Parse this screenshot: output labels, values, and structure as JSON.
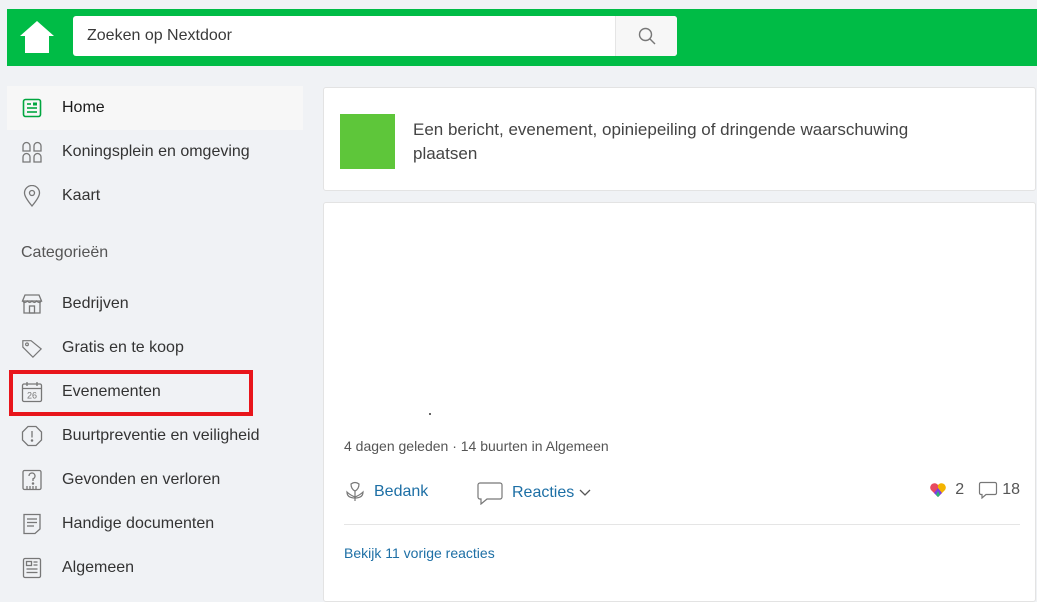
{
  "search": {
    "placeholder": "Zoeken op Nextdoor"
  },
  "sidebar": {
    "items": [
      {
        "label": "Home",
        "icon": "newsfeed-icon"
      },
      {
        "label": "Koningsplein en omgeving",
        "icon": "neighborhood-icon"
      },
      {
        "label": "Kaart",
        "icon": "map-pin-icon"
      }
    ],
    "categories_title": "Categorieën",
    "categories": [
      {
        "label": "Bedrijven",
        "icon": "store-icon"
      },
      {
        "label": "Gratis en te koop",
        "icon": "price-tag-icon"
      },
      {
        "label": "Evenementen",
        "icon": "calendar-icon",
        "calendar_day": "26"
      },
      {
        "label": "Buurtpreventie en veiligheid",
        "icon": "alert-icon"
      },
      {
        "label": "Gevonden en verloren",
        "icon": "lost-found-icon"
      },
      {
        "label": "Handige documenten",
        "icon": "document-icon"
      },
      {
        "label": "Algemeen",
        "icon": "general-icon"
      }
    ]
  },
  "composer": {
    "prompt": "Een bericht, evenement, opiniepeiling of dringende waarschuwing plaatsen"
  },
  "post": {
    "meta": "4 dagen geleden · 14 buurten in Algemeen",
    "thank_label": "Bedank",
    "reactions_label": "Reacties",
    "thank_count": "2",
    "comment_count": "18",
    "view_previous": "Bekijk 11 vorige reacties"
  },
  "colors": {
    "brand": "#00bc46",
    "avatar": "#5ec63a",
    "link": "#1d6fa5",
    "highlight": "#e8151b"
  }
}
